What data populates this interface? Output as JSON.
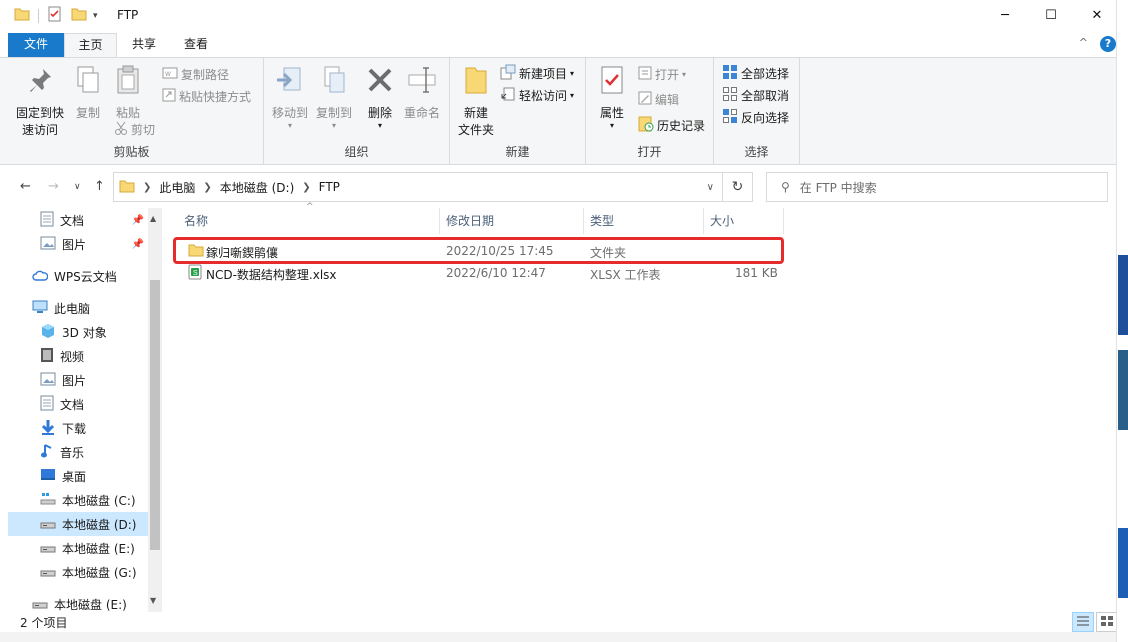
{
  "window": {
    "title": "FTP",
    "minimize_label": "─",
    "maximize_label": "☐",
    "close_label": "✕"
  },
  "tabs": {
    "file": "文件",
    "home": "主页",
    "share": "共享",
    "view": "查看",
    "collapse_glyph": "^",
    "help_glyph": "?"
  },
  "ribbon": {
    "clipboard": {
      "label": "剪贴板",
      "pin_line1": "固定到快",
      "pin_line2": "速访问",
      "copy": "复制",
      "paste": "粘贴",
      "copy_path": "复制路径",
      "paste_shortcut": "粘贴快捷方式",
      "cut": "剪切"
    },
    "organize": {
      "label": "组织",
      "move_to": "移动到",
      "copy_to": "复制到",
      "delete": "删除",
      "rename": "重命名"
    },
    "new": {
      "label": "新建",
      "new_folder_line1": "新建",
      "new_folder_line2": "文件夹",
      "new_item": "新建项目",
      "easy_access": "轻松访问"
    },
    "open": {
      "label": "打开",
      "properties": "属性",
      "open": "打开",
      "edit": "编辑",
      "history": "历史记录"
    },
    "select": {
      "label": "选择",
      "select_all": "全部选择",
      "select_none": "全部取消",
      "invert": "反向选择"
    }
  },
  "address": {
    "crumbs": [
      "此电脑",
      "本地磁盘 (D:)",
      "FTP"
    ],
    "search_placeholder": "在 FTP 中搜索"
  },
  "navpane": {
    "quick": [
      {
        "label": "文档",
        "pinned": true
      },
      {
        "label": "图片",
        "pinned": true
      }
    ],
    "wps": "WPS云文档",
    "this_pc": "此电脑",
    "items": [
      {
        "label": "3D 对象"
      },
      {
        "label": "视频"
      },
      {
        "label": "图片"
      },
      {
        "label": "文档"
      },
      {
        "label": "下载"
      },
      {
        "label": "音乐"
      },
      {
        "label": "桌面"
      },
      {
        "label": "本地磁盘 (C:)"
      },
      {
        "label": "本地磁盘 (D:)",
        "selected": true
      },
      {
        "label": "本地磁盘 (E:)"
      },
      {
        "label": "本地磁盘 (G:)"
      }
    ],
    "network_drive": "本地磁盘 (E:)"
  },
  "filelist": {
    "columns": {
      "name": "名称",
      "date": "修改日期",
      "type": "类型",
      "size": "大小"
    },
    "rows": [
      {
        "name": "鎵归噺鍥鹃儴",
        "date": "2022/10/25 17:45",
        "type": "文件夹",
        "size": ""
      },
      {
        "name": "NCD-数据结构整理.xlsx",
        "date": "2022/6/10 12:47",
        "type": "XLSX 工作表",
        "size": "181 KB"
      }
    ]
  },
  "status": {
    "item_count": "2 个项目"
  },
  "colors": {
    "accent": "#1979ca",
    "selection": "#cce8ff",
    "highlight_box": "#e52b2b",
    "folder": "#f8d775"
  }
}
